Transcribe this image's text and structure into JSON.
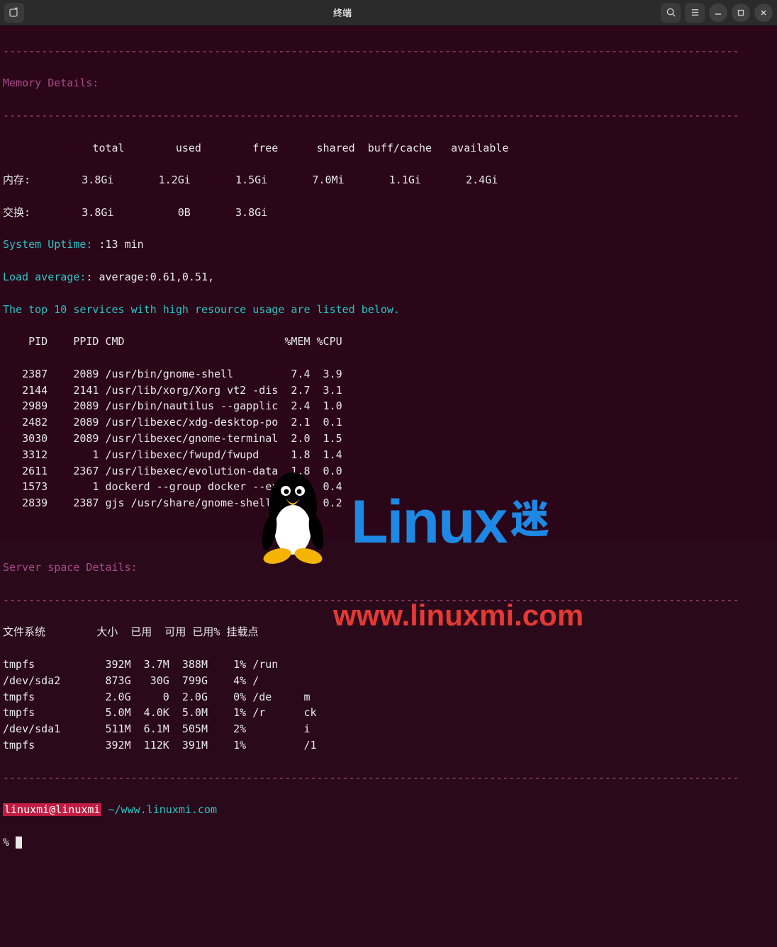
{
  "titlebar": {
    "title": "终端",
    "new_tab_icon": "new-tab-icon",
    "search_icon": "search-icon",
    "menu_icon": "menu-icon",
    "min_icon": "minimize-icon",
    "max_icon": "maximize-icon",
    "close_icon": "close-icon"
  },
  "dashes": "-------------------------------------------------------------------------------------------------------------------",
  "memory_header": "Memory Details:",
  "mem_cols": "              total        used        free      shared  buff/cache   available",
  "mem_row": "内存:        3.8Gi       1.2Gi       1.5Gi       7.0Mi       1.1Gi       2.4Gi",
  "swap_row": "交换:        3.8Gi          0B       3.8Gi",
  "uptime_label": "System Uptime: ",
  "uptime_value": ":13 min",
  "load_label": "Load average:",
  "load_value": ": average:0.61,0.51,",
  "top10": "The top 10 services with high resource usage are listed below.",
  "proc_header": "    PID    PPID CMD                         %MEM %CPU",
  "procs": [
    {
      "line": "   2387    2089 /usr/bin/gnome-shell         7.4  3.9"
    },
    {
      "line": "   2144    2141 /usr/lib/xorg/Xorg vt2 -dis  2.7  3.1"
    },
    {
      "line": "   2989    2089 /usr/bin/nautilus --gapplic  2.4  1.0"
    },
    {
      "line": "   2482    2089 /usr/libexec/xdg-desktop-po  2.1  0.1"
    },
    {
      "line": "   3030    2089 /usr/libexec/gnome-terminal  2.0  1.5"
    },
    {
      "line": "   3312       1 /usr/libexec/fwupd/fwupd     1.8  1.4"
    },
    {
      "line": "   2611    2367 /usr/libexec/evolution-data  1.8  0.0"
    },
    {
      "line": "   1573       1 dockerd --group docker --ex  1.7  0.4"
    },
    {
      "line": "   2839    2387 gjs /usr/share/gnome-shell/  1.7  0.2"
    }
  ],
  "space_header": "Server space Details:",
  "fs_cols": "文件系统        大小  已用  可用 已用% 挂载点",
  "fs": [
    {
      "line": "tmpfs           392M  3.7M  388M    1% /run"
    },
    {
      "line": "/dev/sda2       873G   30G  799G    4% /"
    },
    {
      "line": "tmpfs           2.0G     0  2.0G    0% /de     m"
    },
    {
      "line": "tmpfs           5.0M  4.0K  5.0M    1% /r      ck"
    },
    {
      "line": "/dev/sda1       511M  6.1M  505M    2%         i"
    },
    {
      "line": "tmpfs           392M  112K  391M    1%         /1"
    }
  ],
  "prompt_user": "linuxmi@linuxmi",
  "prompt_path": "~/www.linuxmi.com",
  "prompt_symbol": "% ",
  "watermark": {
    "text": "Linux",
    "cn": "迷",
    "url": "www.linuxmi.com"
  }
}
